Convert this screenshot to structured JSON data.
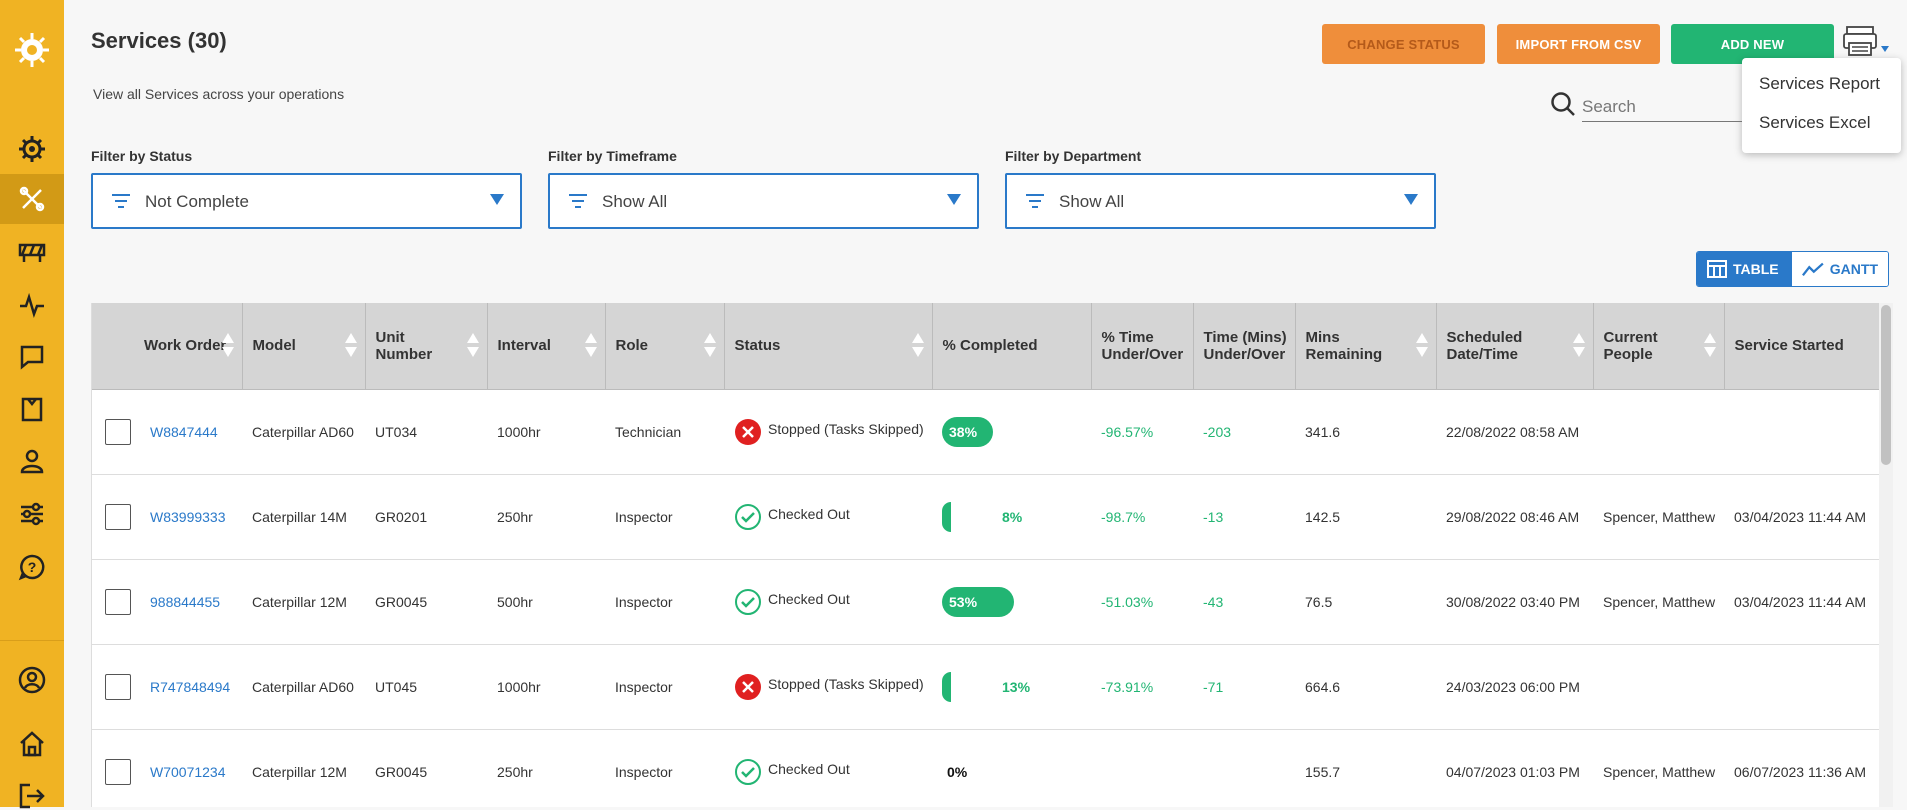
{
  "header": {
    "title": "Services (30)",
    "subtitle": "View all Services across your operations",
    "change_status_label": "CHANGE STATUS",
    "import_label": "IMPORT FROM CSV",
    "add_new_label": "ADD NEW"
  },
  "print_menu": {
    "items": [
      "Services Report",
      "Services Excel"
    ]
  },
  "search": {
    "placeholder": "Search"
  },
  "filters": [
    {
      "label": "Filter by Status",
      "value": "Not Complete"
    },
    {
      "label": "Filter by Timeframe",
      "value": "Show All"
    },
    {
      "label": "Filter by Department",
      "value": "Show All"
    }
  ],
  "view_toggle": {
    "table_label": "TABLE",
    "gantt_label": "GANTT",
    "active": "table"
  },
  "colors": {
    "sidebar": "#f0b323",
    "accent_blue": "#2a79c9",
    "orange": "#ef8e3b",
    "green": "#22b573",
    "red": "#e02020"
  },
  "table": {
    "columns": [
      "Work Order",
      "Model",
      "Unit Number",
      "Interval",
      "Role",
      "Status",
      "% Completed",
      "% Time Under/Over",
      "Time (Mins) Under/Over",
      "Mins Remaining",
      "Scheduled Date/Time",
      "Current People",
      "Service Started"
    ],
    "rows": [
      {
        "work_order": "W8847444",
        "model": "Caterpillar AD60",
        "unit": "UT034",
        "interval": "1000hr",
        "role": "Technician",
        "status": "Stopped (Tasks Skipped)",
        "status_icon": "x-circle-icon",
        "pct": 38,
        "pct_label": "38%",
        "time_pct": "-96.57%",
        "time_mins": "-203",
        "mins_remaining": "341.6",
        "scheduled": "22/08/2022 08:58 AM",
        "people": "",
        "started": ""
      },
      {
        "work_order": "W83999333",
        "model": "Caterpillar 14M",
        "unit": "GR0201",
        "interval": "250hr",
        "role": "Inspector",
        "status": "Checked Out",
        "status_icon": "check-circle-icon",
        "pct": 8,
        "pct_label": "8%",
        "time_pct": "-98.7%",
        "time_mins": "-13",
        "mins_remaining": "142.5",
        "scheduled": "29/08/2022 08:46 AM",
        "people": "Spencer, Matthew",
        "started": "03/04/2023 11:44 AM"
      },
      {
        "work_order": "988844455",
        "model": "Caterpillar 12M",
        "unit": "GR0045",
        "interval": "500hr",
        "role": "Inspector",
        "status": "Checked Out",
        "status_icon": "check-circle-icon",
        "pct": 53,
        "pct_label": "53%",
        "time_pct": "-51.03%",
        "time_mins": "-43",
        "mins_remaining": "76.5",
        "scheduled": "30/08/2022 03:40 PM",
        "people": "Spencer, Matthew",
        "started": "03/04/2023 11:44 AM"
      },
      {
        "work_order": "R747848494",
        "model": "Caterpillar AD60",
        "unit": "UT045",
        "interval": "1000hr",
        "role": "Inspector",
        "status": "Stopped (Tasks Skipped)",
        "status_icon": "x-circle-icon",
        "pct": 13,
        "pct_label": "13%",
        "time_pct": "-73.91%",
        "time_mins": "-71",
        "mins_remaining": "664.6",
        "scheduled": "24/03/2023 06:00 PM",
        "people": "",
        "started": ""
      },
      {
        "work_order": "W70071234",
        "model": "Caterpillar 12M",
        "unit": "GR0045",
        "interval": "250hr",
        "role": "Inspector",
        "status": "Checked Out",
        "status_icon": "check-circle-icon",
        "pct": 0,
        "pct_label": "0%",
        "time_pct": "",
        "time_mins": "",
        "mins_remaining": "155.7",
        "scheduled": "04/07/2023 01:03 PM",
        "people": "Spencer, Matthew",
        "started": "06/07/2023 11:36 AM"
      }
    ]
  }
}
